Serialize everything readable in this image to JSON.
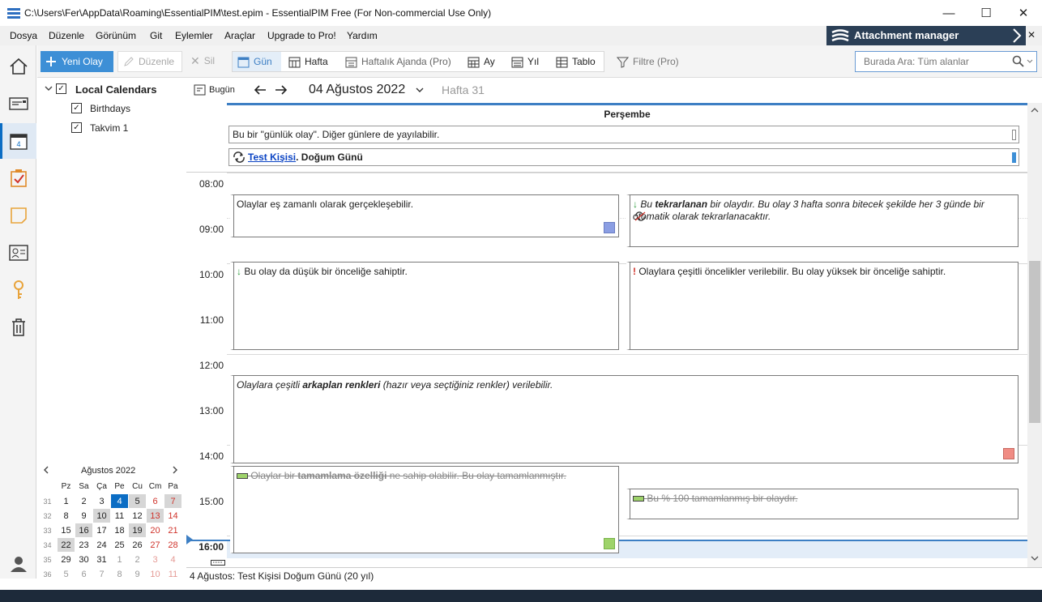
{
  "window": {
    "title": "C:\\Users\\Fer\\AppData\\Roaming\\EssentialPIM\\test.epim - EssentialPIM Free (For Non-commercial Use Only)",
    "minimize": "—",
    "maximize": "☐",
    "close": "✕"
  },
  "menu": [
    "Dosya",
    "Düzenle",
    "Görünüm",
    "Git",
    "Eylemler",
    "Araçlar",
    "Upgrade to Pro!",
    "Yardım"
  ],
  "attachment_manager": "Attachment manager",
  "toolbar": {
    "new_event": "Yeni Olay",
    "edit": "Düzenle",
    "delete": "Sil",
    "day": "Gün",
    "week": "Hafta",
    "weekly_agenda": "Haftalık Ajanda (Pro)",
    "month": "Ay",
    "year": "Yıl",
    "table": "Tablo",
    "filter": "Filtre (Pro)",
    "search_placeholder": "Burada Ara: Tüm alanlar"
  },
  "calendars": {
    "root": "Local Calendars",
    "items": [
      "Birthdays",
      "Takvim 1"
    ]
  },
  "mini_calendar": {
    "title": "Ağustos  2022",
    "weekdays": [
      "Pz",
      "Sa",
      "Ça",
      "Pe",
      "Cu",
      "Cm",
      "Pa"
    ],
    "weeks": [
      {
        "wk": "31",
        "days": [
          "1",
          "2",
          "3",
          "4",
          "5",
          "6",
          "7"
        ]
      },
      {
        "wk": "32",
        "days": [
          "8",
          "9",
          "10",
          "11",
          "12",
          "13",
          "14"
        ]
      },
      {
        "wk": "33",
        "days": [
          "15",
          "16",
          "17",
          "18",
          "19",
          "20",
          "21"
        ]
      },
      {
        "wk": "34",
        "days": [
          "22",
          "23",
          "24",
          "25",
          "26",
          "27",
          "28"
        ]
      },
      {
        "wk": "35",
        "days": [
          "29",
          "30",
          "31",
          "1",
          "2",
          "3",
          "4"
        ]
      },
      {
        "wk": "36",
        "days": [
          "5",
          "6",
          "7",
          "8",
          "9",
          "10",
          "11"
        ]
      }
    ]
  },
  "nav": {
    "today": "Bugün",
    "date": "04 Ağustos 2022",
    "week": "Hafta 31"
  },
  "day_header": "Perşembe",
  "allday": {
    "event1": "Bu bir \"günlük olay\". Diğer günlere de yayılabilir.",
    "event2_link": "Test Kişisi",
    "event2_rest": ". Doğum Günü"
  },
  "hours": [
    "08:00",
    "09:00",
    "10:00",
    "11:00",
    "12:00",
    "13:00",
    "14:00",
    "15:00",
    "16:00"
  ],
  "events": {
    "e1": "Olaylar eş zamanlı olarak gerçekleşebilir.",
    "e2_pre": "Bu ",
    "e2_bold": "tekrarlanan",
    "e2_post": "  bir olaydır. Bu olay 3 hafta sonra bitecek şekilde her 3 günde bir otomatik olarak tekrarlanacaktır.",
    "e3": "Bu olay da düşük bir önceliğe sahiptir.",
    "e4": "Olaylara çeşitli öncelikler verilebilir. Bu olay yüksek bir önceliğe sahiptir.",
    "e5_pre": "Olaylara çeşitli ",
    "e5_bold": "arkaplan renkleri",
    "e5_post": "  (hazır veya seçtiğiniz renkler) verilebilir.",
    "e6_pre": "Olaylar bir ",
    "e6_bold": "tamamlama özelliği",
    "e6_post": " ne sahip olabilir. Bu olay tamamlanmıştır.",
    "e7": "Bu % 100 tamamlanmış bir olaydır."
  },
  "status": "4 Ağustos:  Test Kişisi Doğum Günü  (20 yıl)",
  "colors": {
    "accent": "#3d8fd6",
    "today": "#0b6dc4",
    "weekend": "#d0342c",
    "swatch_blue": "#8b9ee3",
    "swatch_red": "#f08c84",
    "swatch_green": "#9ed36a"
  }
}
